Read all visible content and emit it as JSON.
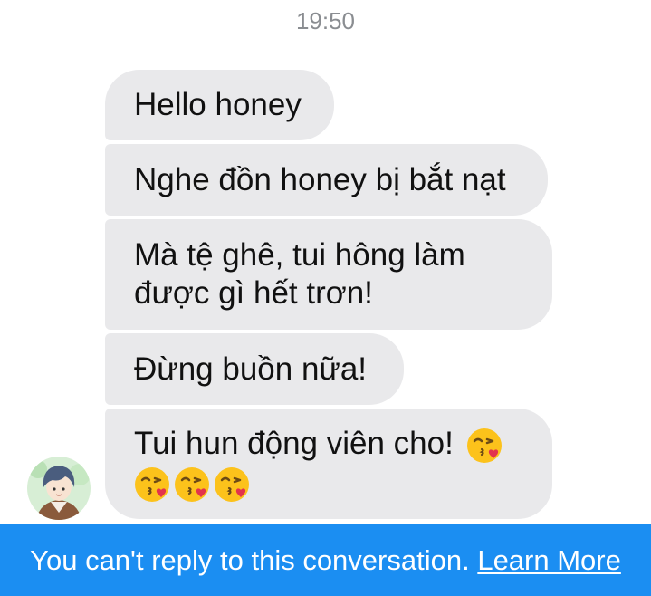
{
  "conversation": {
    "timestamp": "19:50",
    "messages": [
      {
        "text": "Hello honey"
      },
      {
        "text": "Nghe đồn honey bị bắt nạt"
      },
      {
        "line1": "Mà tệ ghê, tui hông làm",
        "line2": "được gì hết trơn!"
      },
      {
        "text": "Đừng buồn nữa!"
      },
      {
        "line1": "Tui hun động viên cho!",
        "emoji_icons": [
          "kissing-heart-emoji",
          "kissing-heart-emoji",
          "kissing-heart-emoji",
          "kissing-heart-emoji"
        ]
      }
    ]
  },
  "footer": {
    "notice": "You can't reply to this conversation.",
    "link_label": "Learn More"
  },
  "colors": {
    "bubble": "#e9e9eb",
    "footer_bg": "#1b8ef2",
    "timestamp": "#8a8d91"
  }
}
